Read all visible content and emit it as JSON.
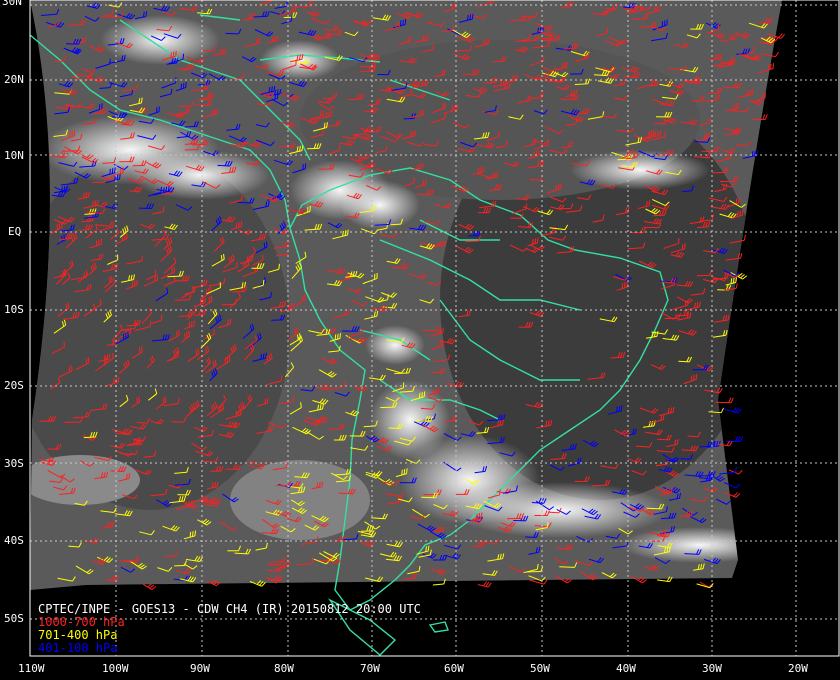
{
  "title": "CPTEC/INPE - GOES13 - CDW CH4 (IR) 20150812 20:00 UTC",
  "legend": [
    {
      "label": "1000-700 hPa",
      "color": "#ff2020"
    },
    {
      "label": "701-400 hPa",
      "color": "#ffff00"
    },
    {
      "label": "401-100 hPa",
      "color": "#0000ff"
    }
  ],
  "colors": {
    "coastline": "#33e0a0",
    "grid": "#c8c8c8",
    "background": "#000000"
  },
  "latitude_labels": [
    "30N",
    "20N",
    "10N",
    "EQ",
    "10S",
    "20S",
    "30S",
    "40S",
    "50S"
  ],
  "longitude_labels": [
    "110W",
    "100W",
    "90W",
    "80W",
    "70W",
    "60W",
    "50W",
    "40W",
    "30W",
    "20W"
  ]
}
